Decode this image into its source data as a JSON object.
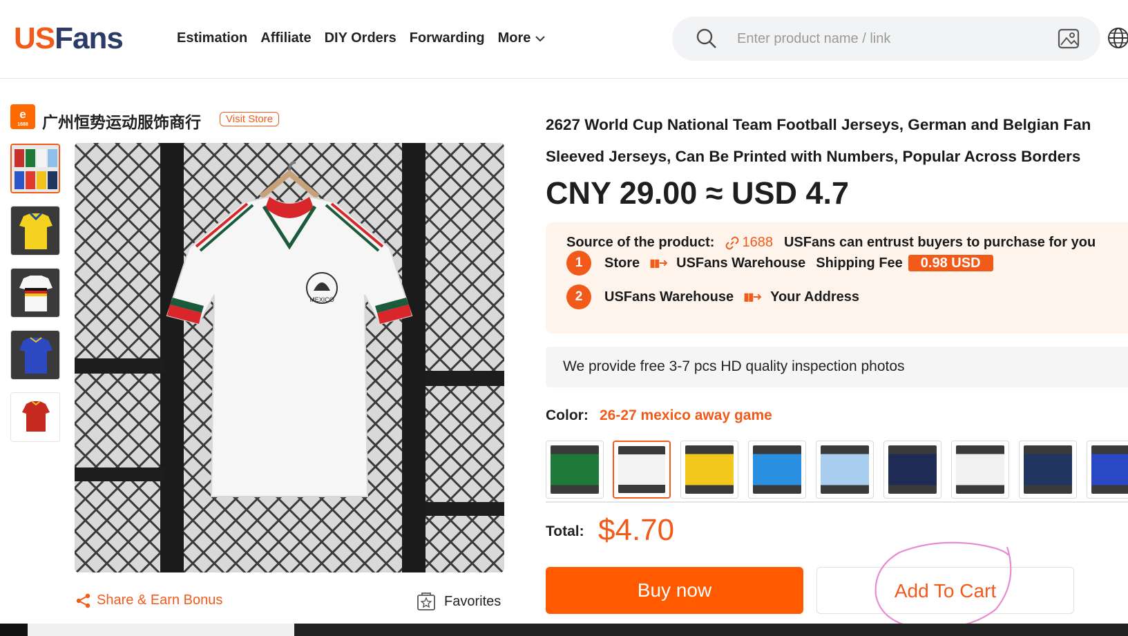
{
  "header": {
    "logo": {
      "part1": "US",
      "part2": "Fans"
    },
    "nav": [
      "Estimation",
      "Affiliate",
      "DIY Orders",
      "Forwarding"
    ],
    "more_label": "More",
    "search_placeholder": "Enter product name / link"
  },
  "store": {
    "logo_text": "1688",
    "name": "广州恒势运动服饰商行",
    "visit_label": "Visit Store"
  },
  "gallery": {
    "thumb_colors": [
      [
        "#c8312b",
        "#f2c318",
        "#2b55c9",
        "#e23a2d"
      ],
      [
        "#f4d21f"
      ],
      [
        "#ffffff"
      ],
      [
        "#2d49c2"
      ],
      [
        "#c72a1f"
      ]
    ],
    "main_jersey_label": "MEXICO"
  },
  "actions": {
    "share_label": "Share & Earn Bonus",
    "favorites_label": "Favorites"
  },
  "product": {
    "title_line1": "2627 World Cup National Team Football Jerseys, German and Belgian Fan",
    "title_line2": "Sleeved Jerseys, Can Be Printed with Numbers, Popular Across Borders",
    "price": "CNY 29.00 ≈ USD 4.7"
  },
  "source": {
    "label": "Source of the product:",
    "platform": "1688",
    "note": "USFans can entrust buyers to purchase for you",
    "step1": {
      "num": "1",
      "from": "Store",
      "to": "USFans Warehouse",
      "fee_label": "Shipping Fee",
      "fee": "0.98 USD"
    },
    "step2": {
      "num": "2",
      "from": "USFans Warehouse",
      "to": "Your Address"
    }
  },
  "inspection": "We provide free 3-7 pcs HD quality inspection photos",
  "color": {
    "label": "Color:",
    "selected": "26-27 mexico away game",
    "swatches": [
      "#1f7a3a",
      "#f3f3f3",
      "#f2c81d",
      "#2a8fe0",
      "#a9cdee",
      "#1e2c56",
      "#f1f1f1",
      "#203660",
      "#2948c4"
    ]
  },
  "total": {
    "label": "Total:",
    "value": "$4.70"
  },
  "buttons": {
    "buy": "Buy now",
    "cart": "Add To Cart"
  },
  "colors": {
    "accent": "#f25a1a",
    "brand_navy": "#2b3a66"
  }
}
